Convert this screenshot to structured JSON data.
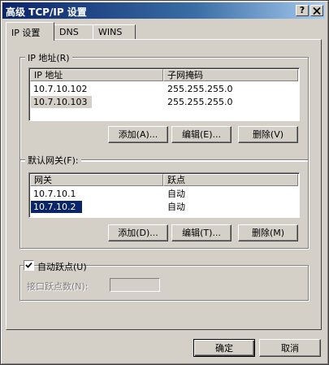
{
  "window": {
    "title": "高级 TCP/IP 设置",
    "help_label": "?",
    "close_label": "X"
  },
  "tabs": [
    {
      "label": "IP 设置",
      "active": true
    },
    {
      "label": "DNS",
      "active": false
    },
    {
      "label": "WINS",
      "active": false
    }
  ],
  "ip_group": {
    "label": "IP 地址(R)",
    "columns": [
      "IP 地址",
      "子网掩码"
    ],
    "rows": [
      {
        "ip": "10.7.10.102",
        "mask": "255.255.255.0"
      },
      {
        "ip": "10.7.10.103",
        "mask": "255.255.255.0"
      }
    ],
    "buttons": {
      "add": "添加(A)...",
      "edit": "编辑(E)...",
      "delete": "删除(V)"
    }
  },
  "gateway_group": {
    "label": "默认网关(F):",
    "columns": [
      "网关",
      "跃点"
    ],
    "rows": [
      {
        "gateway": "10.7.10.1",
        "metric": "自动"
      },
      {
        "gateway": "10.7.10.2",
        "metric": "自动"
      }
    ],
    "buttons": {
      "add": "添加(D)...",
      "edit": "编辑(T)...",
      "delete": "删除(M)"
    }
  },
  "metric_group": {
    "auto_metric_label": "自动跃点(U)",
    "auto_metric_checked": true,
    "interface_metric_label": "接口跃点数(N):",
    "interface_metric_value": ""
  },
  "footer": {
    "ok": "确定",
    "cancel": "取消"
  }
}
